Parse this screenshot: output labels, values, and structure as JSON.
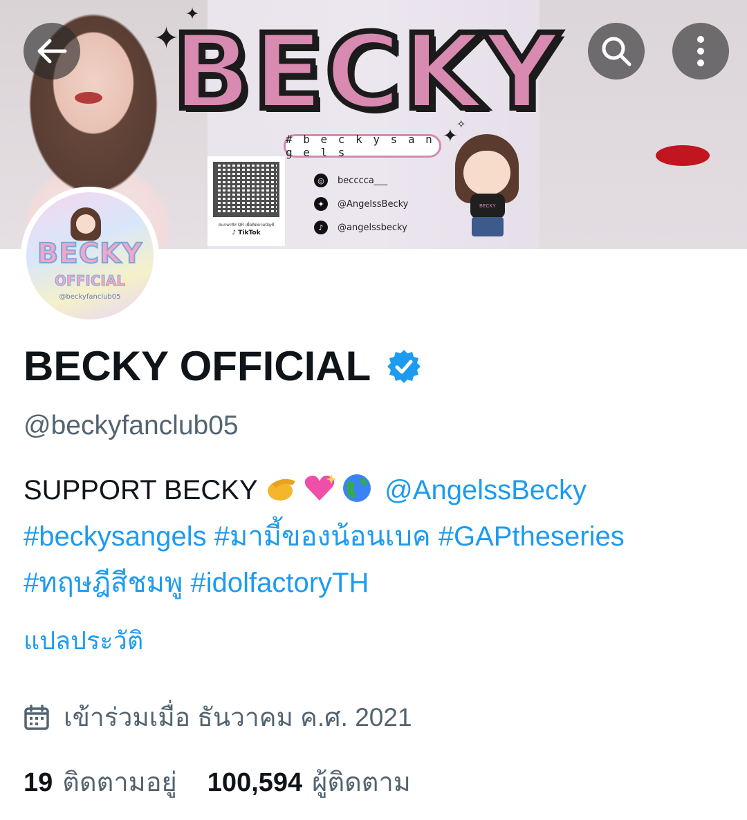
{
  "banner": {
    "title": "BECKY",
    "hashtag": "# b e c k y s a n g e l s",
    "qr_caption": "สแกนรหัส QR เพื่อติดตามบัญชี",
    "qr_tiktok": "TikTok",
    "social": [
      {
        "icon": "instagram-icon",
        "text": "becccca___"
      },
      {
        "icon": "twitter-icon",
        "text": "@AngelssBecky"
      },
      {
        "icon": "tiktok-icon",
        "text": "@angelssbecky"
      }
    ],
    "chibi_shirt": "BECKY"
  },
  "nav": {
    "back": "back-arrow-icon",
    "search": "search-icon",
    "more": "more-vertical-icon"
  },
  "avatar": {
    "name": "BECKY",
    "sub": "OFFICIAL",
    "handle": "@beckyfanclub05"
  },
  "profile": {
    "display_name": "BECKY OFFICIAL",
    "verified": true,
    "handle": "@beckyfanclub05",
    "bio_text": "SUPPORT BECKY ",
    "bio_mention": "@AngelssBecky",
    "bio_tags_line1": "#beckysangels #มามี้ของน้อนเบค #GAPtheseries",
    "bio_tags_line2": "#ทฤษฎีสีชมพู #idolfactoryTH",
    "translate": "แปลประวัติ",
    "joined": "เข้าร่วมเมื่อ ธันวาคม ค.ศ. 2021",
    "following_count": "19",
    "following_label": "ติดตามอยู่",
    "followers_count": "100,594",
    "followers_label": "ผู้ติดตาม"
  },
  "colors": {
    "link": "#1d9bf0",
    "secondary_text": "#536471",
    "primary_text": "#0f1419",
    "banner_pink": "#d88ab0"
  }
}
